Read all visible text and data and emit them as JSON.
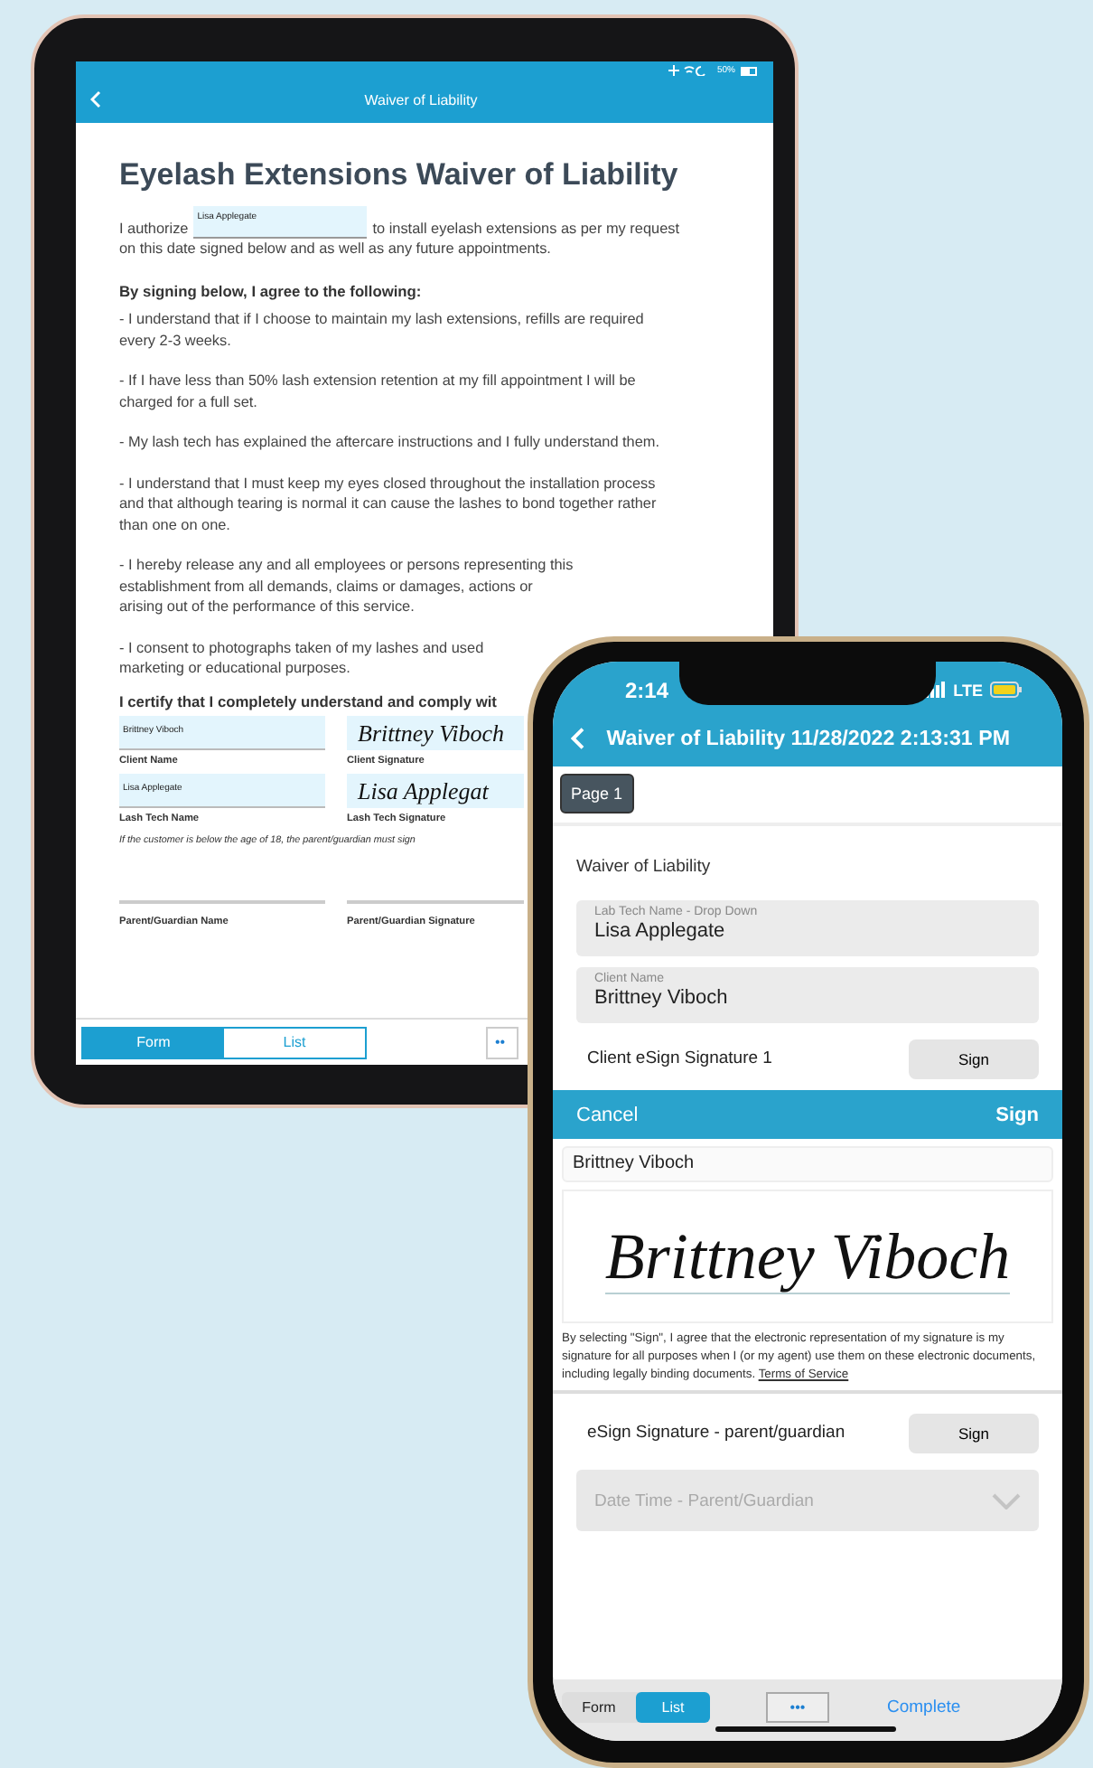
{
  "tablet": {
    "battery": "50%",
    "title": "Waiver of Liability",
    "document": {
      "title": "Eyelash Extensions Waiver of Liability",
      "authorize": {
        "before": "I authorize",
        "field": "Lisa Applegate",
        "after": "to install eyelash extensions as per my request",
        "rest": "on this date signed below and as well as any future appointments."
      },
      "agree_heading": "By signing below, I agree to the following:",
      "clauses": [
        {
          "lines": [
            "- I understand that if I choose to maintain my lash extensions, refills are required",
            "every 2-3 weeks."
          ]
        },
        {
          "lines": [
            "- If I have less than 50% lash extension retention at my fill appointment I will be",
            "charged for a full set."
          ]
        },
        {
          "lines": [
            "- My lash tech has explained the aftercare instructions and I fully understand them."
          ]
        },
        {
          "lines": [
            "- I understand that I must keep my eyes closed throughout the installation process",
            "and that although tearing is normal it can cause the lashes to bond together rather",
            "than one on one."
          ]
        },
        {
          "lines": [
            "- I hereby release any and all employees or persons representing this",
            "establishment from all demands, claims or damages, actions or",
            "arising out of the performance of this service."
          ]
        },
        {
          "lines": [
            "- I consent to photographs taken of my lashes and used",
            "marketing or educational purposes."
          ]
        }
      ],
      "certify": "I certify that I completely understand and comply wit",
      "signature_rows": [
        {
          "name_value": "Brittney Viboch",
          "name_label": "Client Name",
          "signature": "Brittney Viboch",
          "signature_label": "Client Signature"
        },
        {
          "name_value": "Lisa Applegate",
          "name_label": "Lash Tech Name",
          "signature": "Lisa Applegat",
          "signature_label": "Lash Tech Signature"
        }
      ],
      "minor_note": "If the customer is below the age of 18, the parent/guardian must sign",
      "guardian_labels": [
        "Parent/Guardian Name",
        "Parent/Guardian Signature"
      ]
    },
    "tabs": [
      {
        "label": "Form",
        "selected": true
      },
      {
        "label": "List",
        "selected": false
      }
    ],
    "more_button": "••"
  },
  "phone": {
    "time": "2:14",
    "network": "LTE",
    "title": "Waiver of Liability 11/28/2022 2:13:31 PM",
    "page_tab": "Page 1",
    "section_title": "Waiver of Liability",
    "fields": [
      {
        "label": "Lab Tech Name - Drop Down",
        "value": "Lisa Applegate"
      },
      {
        "label": "Client Name",
        "value": "Brittney Viboch"
      }
    ],
    "sign_row": {
      "label": "Client eSign Signature 1",
      "button": "Sign"
    },
    "sheet": {
      "cancel": "Cancel",
      "confirm": "Sign",
      "name": "Brittney Viboch",
      "signature": "Brittney Viboch",
      "disclaimer": "By selecting \"Sign\", I agree that the electronic representation of my signature is my signature for all purposes when I (or my agent) use them on these electronic documents, including legally binding documents.",
      "terms_link": "Terms of Service"
    },
    "guardian_row": {
      "label": "eSign Signature - parent/guardian",
      "button": "Sign"
    },
    "date_dropdown": {
      "placeholder": "Date Time - Parent/Guardian"
    },
    "tabs": [
      {
        "label": "Form",
        "selected": false
      },
      {
        "label": "List",
        "selected": true
      }
    ],
    "more_button": "•••",
    "complete": "Complete"
  }
}
